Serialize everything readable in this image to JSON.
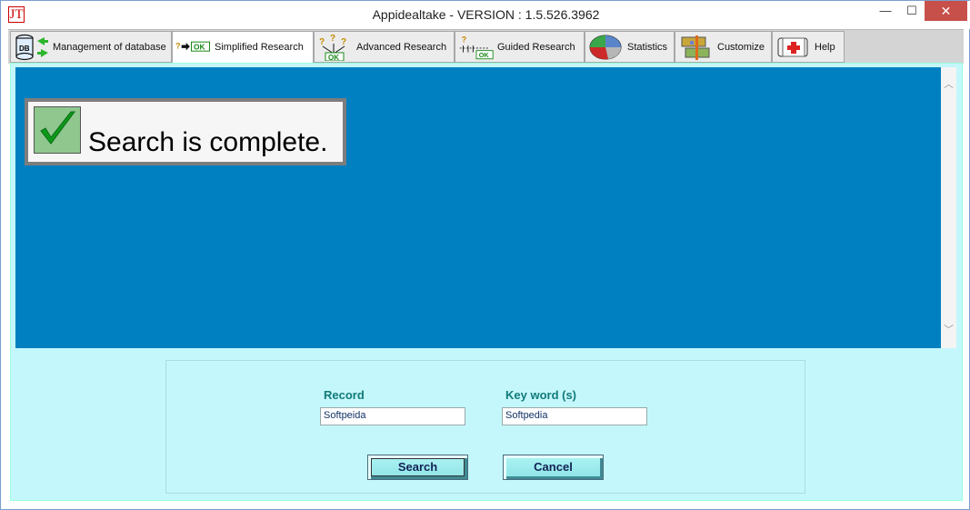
{
  "window": {
    "title": "Appidealtake - VERSION : 1.5.526.3962",
    "app_icon_glyph": "JT",
    "minimize_glyph": "—",
    "maximize_glyph": "☐",
    "close_glyph": "✕"
  },
  "tabs": [
    {
      "label": "Management of database",
      "icon": "database-icon",
      "active": false
    },
    {
      "label": "Simplified Research",
      "icon": "simplified-research-icon",
      "active": true
    },
    {
      "label": "Advanced Research",
      "icon": "advanced-research-icon",
      "active": false
    },
    {
      "label": "Guided Research",
      "icon": "guided-research-icon",
      "active": false
    },
    {
      "label": "Statistics",
      "icon": "pie-chart-icon",
      "active": false
    },
    {
      "label": "Customize",
      "icon": "customize-icon",
      "active": false
    },
    {
      "label": "Help",
      "icon": "first-aid-icon",
      "active": false
    }
  ],
  "status": {
    "message": "Search is complete."
  },
  "form": {
    "record_label": "Record",
    "record_value": "Softpeida",
    "keyword_label": "Key word (s)",
    "keyword_value": "Softpedia",
    "search_button": "Search",
    "cancel_button": "Cancel"
  },
  "colors": {
    "panel_blue": "#0080c0",
    "background_cyan": "#c4f7fb",
    "label_teal": "#117a7a",
    "check_green": "#8fc78f"
  }
}
